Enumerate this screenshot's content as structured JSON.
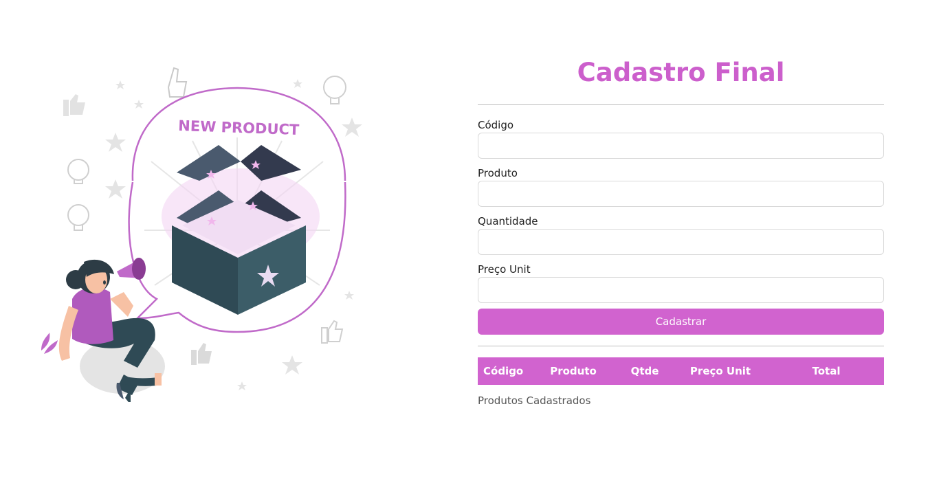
{
  "title": "Cadastro Final",
  "illustration": {
    "banner_text": "NEW PRODUCT"
  },
  "form": {
    "fields": [
      {
        "label": "Código",
        "value": "",
        "placeholder": ""
      },
      {
        "label": "Produto",
        "value": "",
        "placeholder": ""
      },
      {
        "label": "Quantidade",
        "value": "",
        "placeholder": ""
      },
      {
        "label": "Preço Unit",
        "value": "",
        "placeholder": ""
      }
    ],
    "submit_label": "Cadastrar"
  },
  "table": {
    "headers": [
      "Código",
      "Produto",
      "Qtde",
      "Preço Unit",
      "Total"
    ],
    "caption": "Produtos Cadastrados"
  },
  "colors": {
    "accent": "#d163cf",
    "title": "#cc5fcc"
  }
}
